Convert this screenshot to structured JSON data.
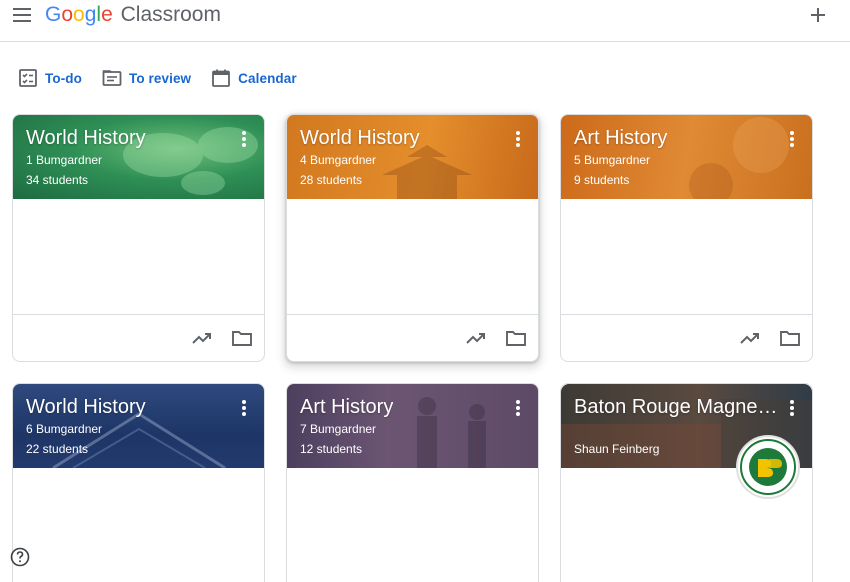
{
  "header": {
    "logo_google": [
      "G",
      "o",
      "o",
      "g",
      "l",
      "e"
    ],
    "logo_product": "Classroom"
  },
  "quicknav": [
    {
      "label": "To-do",
      "icon": "todo-icon"
    },
    {
      "label": "To review",
      "icon": "review-icon"
    },
    {
      "label": "Calendar",
      "icon": "calendar-icon"
    }
  ],
  "classes": [
    {
      "title": "World History",
      "section": "1 Bumgardner",
      "students": "34 students",
      "theme": "green"
    },
    {
      "title": "World History",
      "section": "4 Bumgardner",
      "students": "28 students",
      "theme": "orange"
    },
    {
      "title": "Art History",
      "section": "5 Bumgardner",
      "students": "9 students",
      "theme": "orange"
    },
    {
      "title": "World History",
      "section": "6 Bumgardner",
      "students": "22 students",
      "theme": "blue"
    },
    {
      "title": "Art History",
      "section": "7 Bumgardner",
      "students": "12 students",
      "theme": "purple"
    },
    {
      "title": "Baton Rouge Magnet High School",
      "owner": "Shaun Feinberg",
      "theme": "brick"
    }
  ],
  "colors": {
    "accent": "#1967d2",
    "icon_gray": "#5f6368",
    "border": "#dadce0"
  }
}
